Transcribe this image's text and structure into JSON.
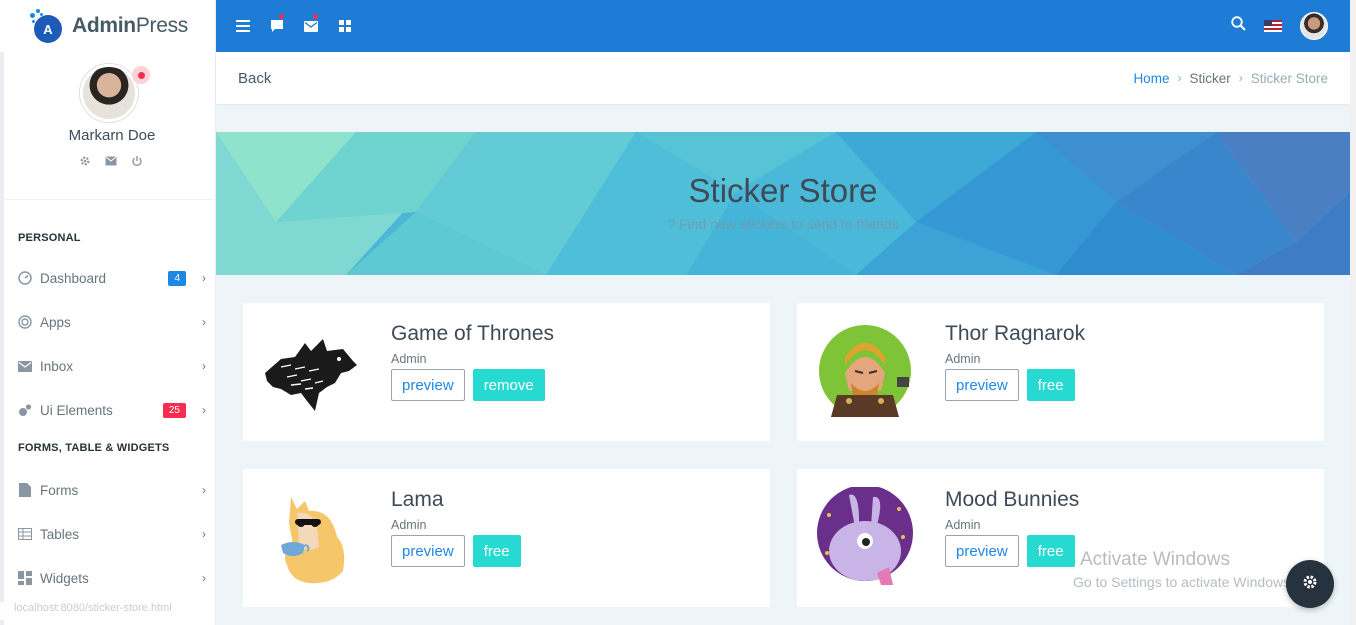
{
  "brand": {
    "name_bold": "Admin",
    "name_light": "Press"
  },
  "profile": {
    "name": "Markarn Doe"
  },
  "sidebar": {
    "personal_caption": "PERSONAL",
    "personal_items": [
      {
        "label": "Dashboard",
        "icon": "gauge-icon",
        "badge": "4",
        "badge_color": "#1e88e5"
      },
      {
        "label": "Apps",
        "icon": "target-icon"
      },
      {
        "label": "Inbox",
        "icon": "mail-icon"
      },
      {
        "label": "Ui Elements",
        "icon": "bubbles-icon",
        "badge": "25",
        "badge_color": "#f62d51"
      }
    ],
    "forms_caption": "FORMS, TABLE & WIDGETS",
    "forms_items": [
      {
        "label": "Forms",
        "icon": "file-icon"
      },
      {
        "label": "Tables",
        "icon": "table-icon"
      },
      {
        "label": "Widgets",
        "icon": "widgets-icon"
      }
    ]
  },
  "page": {
    "back_label": "Back",
    "breadcrumb": {
      "home": "Home",
      "section": "Sticker",
      "current": "Sticker Store"
    }
  },
  "banner": {
    "title": "Sticker Store",
    "subtitle": "? Find new stickers to send to friends"
  },
  "stickers": [
    {
      "title": "Game of Thrones",
      "author": "Admin",
      "preview": "preview",
      "action": "remove"
    },
    {
      "title": "Thor Ragnarok",
      "author": "Admin",
      "preview": "preview",
      "action": "free"
    },
    {
      "title": "Lama",
      "author": "Admin",
      "preview": "preview",
      "action": "free"
    },
    {
      "title": "Mood Bunnies",
      "author": "Admin",
      "preview": "preview",
      "action": "free"
    }
  ],
  "watermark": {
    "line1": "Activate Windows",
    "line2": "Go to Settings to activate Windows."
  },
  "status_url": "localhost:8080/sticker-store.html",
  "colors": {
    "topbar": "#1e7bd6",
    "accent": "#1e88e5",
    "teal": "#26dad2"
  }
}
